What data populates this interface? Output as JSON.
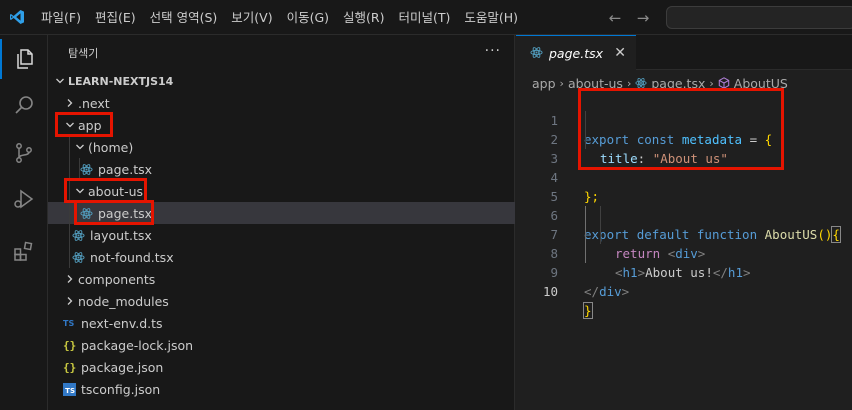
{
  "menu": [
    "파일(F)",
    "편집(E)",
    "선택 영역(S)",
    "보기(V)",
    "이동(G)",
    "실행(R)",
    "터미널(T)",
    "도움말(H)"
  ],
  "colors": {
    "accent": "#0078d4",
    "annotation": "#e51400",
    "react_icon": "#519aba"
  },
  "sidebar": {
    "title": "탐색기",
    "more": "···",
    "section": "LEARN-NEXTJS14",
    "items": [
      {
        "label": ".next",
        "kind": "folder-closed"
      },
      {
        "label": "app",
        "kind": "folder-open"
      },
      {
        "label": "(home)",
        "kind": "folder-open"
      },
      {
        "label": "page.tsx",
        "kind": "react-icon"
      },
      {
        "label": "about-us",
        "kind": "folder-open"
      },
      {
        "label": "page.tsx",
        "kind": "react-icon"
      },
      {
        "label": "layout.tsx",
        "kind": "react-icon"
      },
      {
        "label": "not-found.tsx",
        "kind": "react-icon"
      },
      {
        "label": "components",
        "kind": "folder-closed"
      },
      {
        "label": "node_modules",
        "kind": "folder-closed"
      },
      {
        "label": "next-env.d.ts",
        "kind": "ts-icon",
        "badge": "TS"
      },
      {
        "label": "package-lock.json",
        "kind": "json-icon",
        "badge": "{}"
      },
      {
        "label": "package.json",
        "kind": "json-icon",
        "badge": "{}"
      },
      {
        "label": "tsconfig.json",
        "kind": "tsconfig-icon",
        "badge": "TS"
      }
    ]
  },
  "editor": {
    "tab": {
      "label": "page.tsx",
      "close": "✕"
    },
    "breadcrumb": [
      "app",
      "about-us",
      "page.tsx",
      "AboutUS"
    ],
    "line_numbers": [
      "1",
      "2",
      "3",
      "4",
      "5",
      "6",
      "7",
      "8",
      "9",
      "10"
    ],
    "code": {
      "l1": [
        "export",
        "const",
        "metadata",
        "=",
        "{"
      ],
      "l2": [
        "title",
        ":",
        "\"About us\""
      ],
      "l4": [
        "};"
      ],
      "l6": [
        "export",
        "default",
        "function",
        "AboutUS",
        "(",
        ")",
        "{"
      ],
      "l7": [
        "return",
        "<",
        "div",
        ">"
      ],
      "l8": [
        "<",
        "h1",
        ">",
        "About us!",
        "</",
        "h1",
        ">"
      ],
      "l9": [
        "</",
        "div",
        ">"
      ],
      "l10": [
        "}"
      ]
    }
  }
}
